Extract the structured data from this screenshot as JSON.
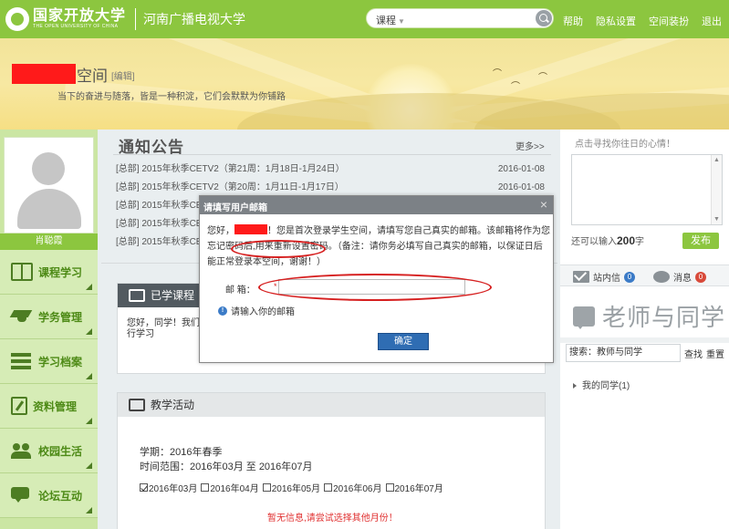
{
  "header": {
    "logo_cn": "国家开放大学",
    "logo_en": "THE OPEN UNIVERSITY OF CHINA",
    "school": "河南广播电视大学",
    "search_scope": "课程",
    "links": [
      "帮助",
      "隐私设置",
      "空间装扮",
      "退出"
    ]
  },
  "banner": {
    "space_suffix": "空间",
    "edit": "[编辑]",
    "motto": "当下的奋进与随落，皆是一种积淀，它们会默默为你铺路"
  },
  "profile": {
    "name": "肖聪霞"
  },
  "sidebar": {
    "items": [
      {
        "label": "课程学习",
        "icon": "book-icon"
      },
      {
        "label": "学务管理",
        "icon": "graduation-cap-icon"
      },
      {
        "label": "学习档案",
        "icon": "list-icon"
      },
      {
        "label": "资料管理",
        "icon": "document-icon"
      },
      {
        "label": "校园生活",
        "icon": "people-icon"
      },
      {
        "label": "论坛互动",
        "icon": "chat-icon"
      }
    ]
  },
  "notice": {
    "title": "通知公告",
    "more": "更多>>",
    "rows": [
      {
        "text": "[总部] 2015年秋季CETV2（第21周：1月18日-1月24日）",
        "date": "2016-01-08"
      },
      {
        "text": "[总部] 2015年秋季CETV2（第20周：1月11日-1月17日）",
        "date": "2016-01-08"
      },
      {
        "text": "[总部] 2015年秋季CE",
        "date": ""
      },
      {
        "text": "[总部] 2015年秋季CE",
        "date": ""
      },
      {
        "text": "[总部] 2015年秋季CE",
        "date": ""
      }
    ]
  },
  "learned": {
    "title": "已学课程",
    "text": "您好，同学！我们行学习"
  },
  "activity": {
    "title": "教学活动",
    "term": "学期：2016年春季",
    "range": "时间范围：2016年03月 至 2016年07月",
    "months": [
      {
        "label": "2016年03月",
        "checked": true
      },
      {
        "label": "2016年04月",
        "checked": false
      },
      {
        "label": "2016年05月",
        "checked": false
      },
      {
        "label": "2016年06月",
        "checked": false
      },
      {
        "label": "2016年07月",
        "checked": false
      }
    ],
    "no_data": "暂无信息,请尝试选择其他月份！"
  },
  "mood": {
    "tip": "点击寻找你往日的心情！",
    "count_prefix": "还可以输入",
    "count": "200",
    "count_suffix": "字",
    "publish": "发布"
  },
  "messages": {
    "inbox_label": "站内信",
    "inbox_count": "0",
    "notify_label": "消息",
    "notify_count": "0"
  },
  "teachers": {
    "title": "老师与同学",
    "search_value": "搜索：教师与同学",
    "find": "查找",
    "reset": "重置",
    "my_classmates": "我的同学(1)"
  },
  "modal": {
    "title": "请填写用户邮箱",
    "close": "×",
    "greeting": "您好，",
    "msg1": "！您是首次登录学生空间，请填写您自己真实的邮箱。该邮箱将作为您忘记密码后,",
    "msg_highlight": "用来重新设置密码。",
    "msg2": "（备注：请你务必填写自己真实的邮箱，以保证日后能正常登录本空间，谢谢！）",
    "email_label": "邮 箱：",
    "email_required": "*",
    "email_value": "",
    "hint": "请输入你的邮箱",
    "ok": "确定"
  },
  "colors": {
    "brand_green": "#8cc63f",
    "sidebar_text": "#4d8a16",
    "modal_header": "#7c8186",
    "button_blue": "#2f6db3",
    "annotation_red": "#d62020"
  }
}
